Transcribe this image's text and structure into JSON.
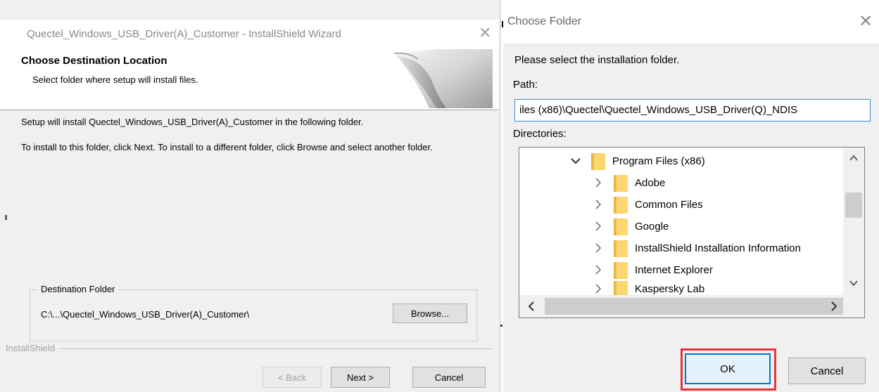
{
  "wizard": {
    "window_title": "Quectel_Windows_USB_Driver(A)_Customer - InstallShield Wizard",
    "close_glyph": "✕",
    "heading": "Choose Destination Location",
    "subheading": "Select folder where setup will install files.",
    "description": "Setup will install Quectel_Windows_USB_Driver(A)_Customer in the following folder.",
    "instructions": "To install to this folder, click Next. To install to a different folder, click Browse and select another folder.",
    "destination_group_label": "Destination Folder",
    "destination_path": "C:\\...\\Quectel_Windows_USB_Driver(A)_Customer\\",
    "browse_label": "Browse...",
    "brand_label": "InstallShield",
    "back_label": "< Back",
    "next_label": "Next >",
    "cancel_label": "Cancel"
  },
  "choose_folder": {
    "window_title": "Choose Folder",
    "close_glyph": "✕",
    "prompt": "Please select the installation folder.",
    "path_label": "Path:",
    "path_value": "iles (x86)\\Quectel\\Quectel_Windows_USB_Driver(Q)_NDIS",
    "directories_label": "Directories:",
    "tree_items": [
      {
        "label": "Program Files (x86)",
        "expanded": true
      },
      {
        "label": "Adobe"
      },
      {
        "label": "Common Files"
      },
      {
        "label": "Google"
      },
      {
        "label": "InstallShield Installation Information"
      },
      {
        "label": "Internet Explorer"
      },
      {
        "label": "Kaspersky Lab"
      }
    ],
    "ok_label": "OK",
    "cancel_label": "Cancel"
  },
  "colors": {
    "highlight_border": "#e8343a",
    "focus_blue": "#0078d7",
    "folder_yellow": "#fcd66e"
  }
}
